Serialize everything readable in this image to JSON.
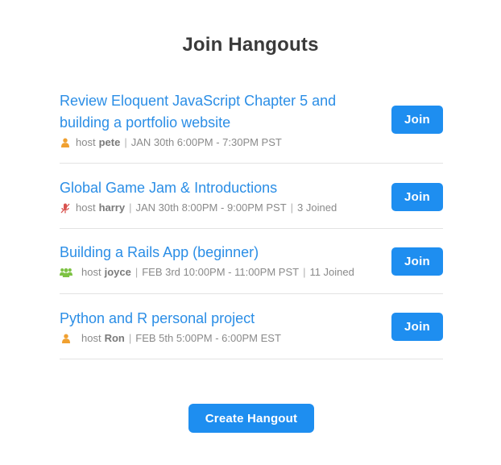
{
  "page": {
    "title": "Join Hangouts"
  },
  "colors": {
    "accent": "#1e8ef0",
    "link": "#2b8ee6",
    "user_icon": "#f0a030",
    "mic_off_icon": "#d9534f",
    "group_icon": "#7dc243"
  },
  "hangouts": [
    {
      "title": "Review Eloquent JavaScript Chapter 5 and building a portfolio website",
      "icon": "user-icon",
      "host_label": "host",
      "host": "pete",
      "time": "JAN 30th 6:00PM - 7:30PM PST",
      "joined": "",
      "join_label": "Join"
    },
    {
      "title": "Global Game Jam & Introductions",
      "icon": "mic-off-icon",
      "host_label": "host",
      "host": "harry",
      "time": "JAN 30th 8:00PM - 9:00PM PST",
      "joined": "3 Joined",
      "join_label": "Join"
    },
    {
      "title": "Building a Rails App (beginner)",
      "icon": "group-icon",
      "host_label": "host",
      "host": "joyce",
      "time": "FEB 3rd 10:00PM - 11:00PM PST",
      "joined": "11 Joined",
      "join_label": "Join"
    },
    {
      "title": "Python and R personal project",
      "icon": "user-icon",
      "host_label": "host",
      "host": "Ron",
      "time": "FEB 5th 5:00PM - 6:00PM EST",
      "joined": "",
      "join_label": "Join"
    }
  ],
  "create_button": {
    "label": "Create Hangout"
  }
}
